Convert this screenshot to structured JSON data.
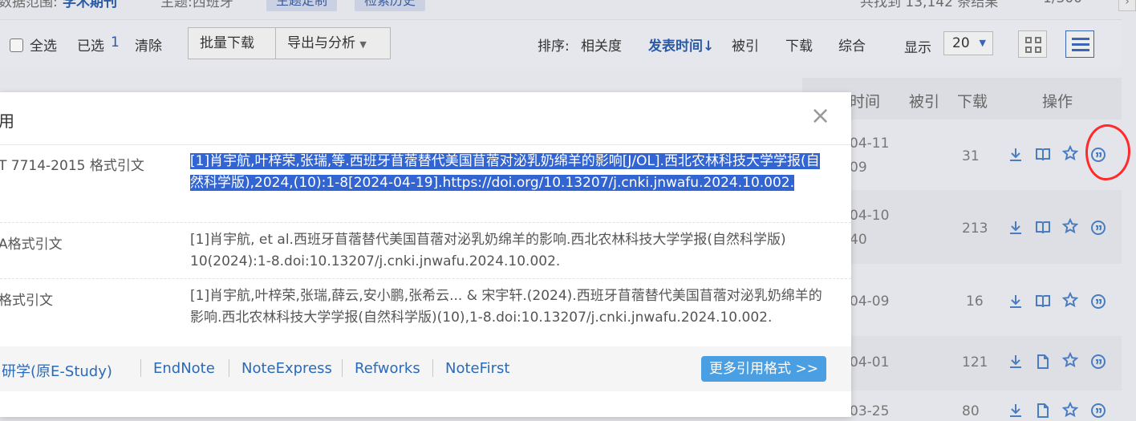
{
  "topbar": {
    "scope_label": "数据范围:",
    "scope_value": "学术期刊",
    "subject_label": "主题:西班牙",
    "pill1": "主题定制",
    "pill2": "检索历史",
    "result_text": "共找到 13,142 条结果",
    "page_text": "1/300",
    "next_arrow": "›"
  },
  "toolbar": {
    "select_all": "全选",
    "selected_label": "已选",
    "selected_count": "1",
    "clear": "清除",
    "batch_download": "批量下载",
    "export_analysis": "导出与分析",
    "sort_label": "排序:",
    "sort_relevance": "相关度",
    "sort_pubtime": "发表时间↓",
    "sort_cited": "被引",
    "sort_download": "下载",
    "sort_combined": "综合",
    "display_label": "显示",
    "page_size": "20"
  },
  "table": {
    "headers": {
      "pubtime": "时间",
      "cited": "被引",
      "download": "下载",
      "operate": "操作"
    },
    "rows": [
      {
        "date1": "04-11",
        "date2": "09",
        "count": "31"
      },
      {
        "date1": "04-10",
        "date2": "40",
        "count": "213"
      },
      {
        "date1": "04-09",
        "date2": "",
        "count": "16"
      },
      {
        "date1": "04-01",
        "date2": "",
        "count": "121"
      },
      {
        "date1": "03-25",
        "date2": "",
        "count": "80"
      }
    ]
  },
  "modal": {
    "title": "用",
    "close": "×",
    "formats": [
      {
        "label": "T 7714-2015 格式引文",
        "citation": "[1]肖宇航,叶梓荣,张瑞,等.西班牙苜蓿替代美国苜蓿对泌乳奶绵羊的影响[J/OL].西北农林科技大学学报(自然科学版),2024,(10):1-8[2024-04-19].https://doi.org/10.13207/j.cnki.jnwafu.2024.10.002."
      },
      {
        "label": "A格式引文",
        "citation": "[1]肖宇航, et al.西班牙苜蓿替代美国苜蓿对泌乳奶绵羊的影响.西北农林科技大学学报(自然科学版) 10(2024):1-8.doi:10.13207/j.cnki.jnwafu.2024.10.002."
      },
      {
        "label": "格式引文",
        "citation": "[1]肖宇航,叶梓荣,张瑞,薛云,安小鹏,张希云... & 宋宇轩.(2024).西班牙苜蓿替代美国苜蓿对泌乳奶绵羊的影响.西北农林科技大学学报(自然科学版)(10),1-8.doi:10.13207/j.cnki.jnwafu.2024.10.002."
      }
    ],
    "ref_tools": [
      "研学(原E-Study)",
      "EndNote",
      "NoteExpress",
      "Refworks",
      "NoteFirst"
    ],
    "more_formats": "更多引用格式 >>"
  },
  "colors": {
    "selection": "#3264d2",
    "link": "#2a6ab8",
    "more_button": "#4a9fe2",
    "annotation": "#ff2a2a"
  }
}
